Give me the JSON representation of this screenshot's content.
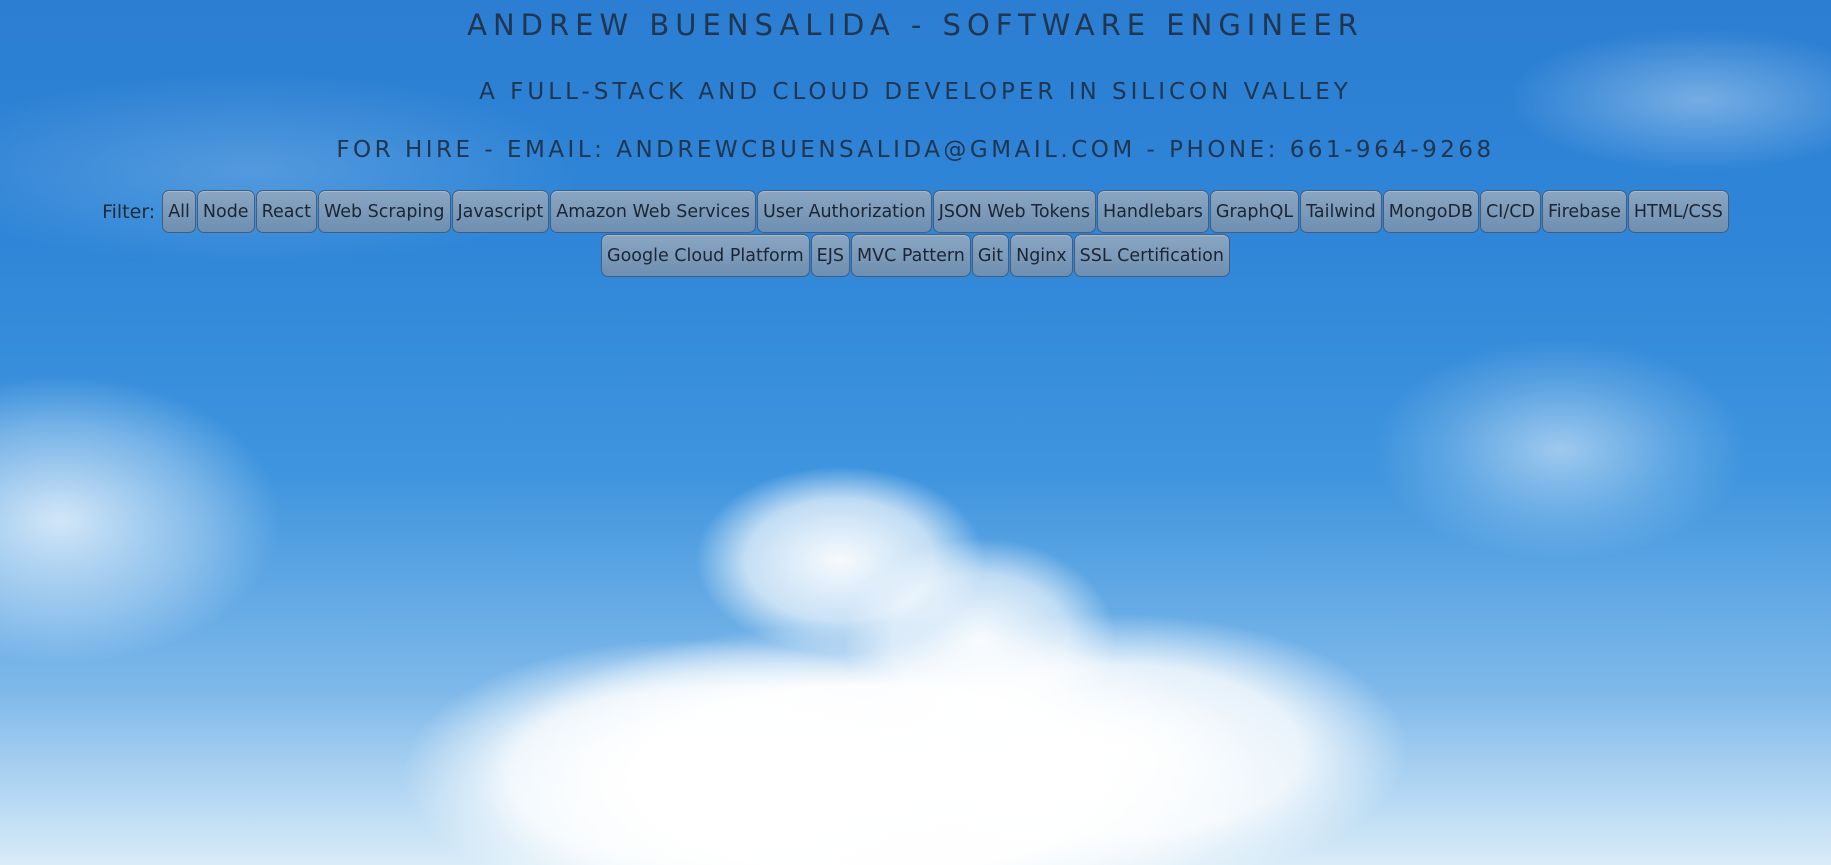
{
  "header": {
    "title": "ANDREW BUENSALIDA - SOFTWARE ENGINEER",
    "subtitle": "A FULL-STACK AND CLOUD DEVELOPER IN SILICON VALLEY",
    "contact": "FOR HIRE - EMAIL: ANDREWCBUENSALIDA@GMAIL.COM - PHONE: 661-964-9268"
  },
  "filter": {
    "label": "Filter:",
    "buttons": [
      "All",
      "Node",
      "React",
      "Web Scraping",
      "Javascript",
      "Amazon Web Services",
      "User Authorization",
      "JSON Web Tokens",
      "Handlebars",
      "GraphQL",
      "Tailwind",
      "MongoDB",
      "CI/CD",
      "Firebase",
      "HTML/CSS",
      "Google Cloud Platform",
      "EJS",
      "MVC Pattern",
      "Git",
      "Nginx",
      "SSL Certification"
    ]
  }
}
